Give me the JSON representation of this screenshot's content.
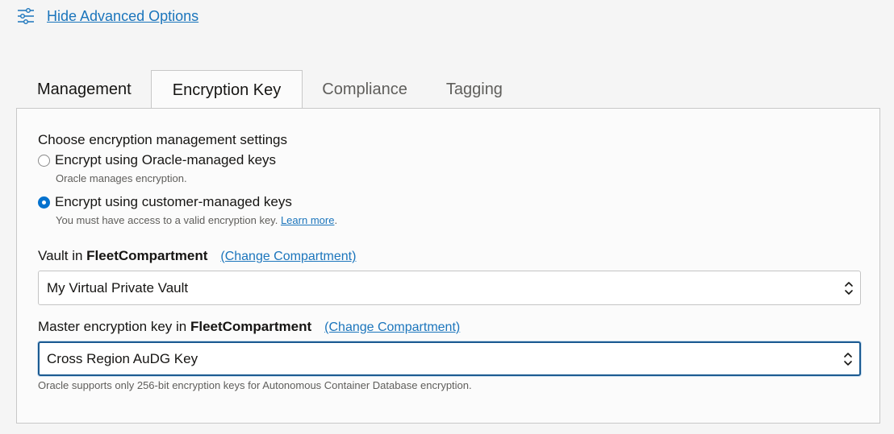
{
  "advanced": {
    "icon": "sliders-icon",
    "label": "Hide Advanced Options"
  },
  "tabs": [
    {
      "label": "Management",
      "active": false
    },
    {
      "label": "Encryption Key",
      "active": true
    },
    {
      "label": "Compliance",
      "active": false
    },
    {
      "label": "Tagging",
      "active": false
    }
  ],
  "encryption": {
    "heading": "Choose encryption management settings",
    "options": [
      {
        "label": "Encrypt using Oracle-managed keys",
        "hint": "Oracle manages encryption.",
        "checked": false
      },
      {
        "label": "Encrypt using customer-managed keys",
        "hint": "You must have access to a valid encryption key.",
        "hint_link": "Learn more",
        "hint_suffix": ".",
        "checked": true
      }
    ]
  },
  "vault": {
    "label_prefix": "Vault in ",
    "compartment": "FleetCompartment",
    "change_link": "(Change Compartment)",
    "selected": "My Virtual Private Vault"
  },
  "master_key": {
    "label_prefix": "Master encryption key in ",
    "compartment": "FleetCompartment",
    "change_link": "(Change Compartment)",
    "selected": "Cross Region AuDG Key",
    "hint": "Oracle supports only 256-bit encryption keys for Autonomous Container Database encryption."
  },
  "colors": {
    "link": "#1b75bc",
    "radio_checked": "#0572ce",
    "focus_border": "#1b5a91"
  }
}
